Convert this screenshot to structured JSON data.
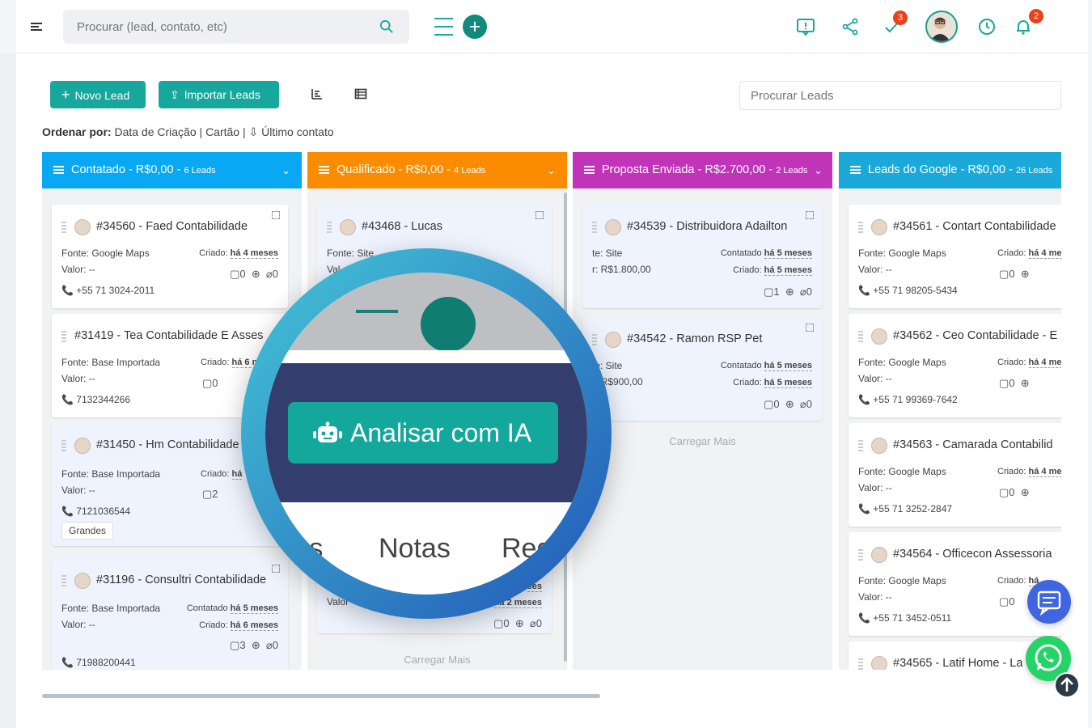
{
  "topbar": {
    "search_placeholder": "Procurar (lead, contato, etc)",
    "tasks_badge": "3",
    "notifications_badge": "2"
  },
  "toolbar": {
    "new_lead": "Novo Lead",
    "import_leads": "Importar Leads",
    "search_leads_placeholder": "Procurar Leads",
    "sort_label": "Ordenar por:",
    "sort_date": "Data de Criação",
    "sort_card": "Cartão",
    "sort_last": "Último contato"
  },
  "columns": [
    {
      "title": "Contatado - R$0,00 -",
      "count": "6 Leads",
      "color": "#0aa8f2"
    },
    {
      "title": "Qualificado - R$0,00 -",
      "count": "4 Leads",
      "color": "#fb8c00"
    },
    {
      "title": "Proposta Enviada - R$2.700,00 -",
      "count": "2 Leads",
      "color": "#c035b8"
    },
    {
      "title": "Leads do Google - R$0,00 -",
      "count": "26 Leads",
      "color": "#1aa9d8"
    }
  ],
  "cards": {
    "c1": {
      "title": "#34560 - Faed Contabilidade",
      "source": "Fonte: Google Maps",
      "value": "Valor: --",
      "created_label": "Criado:",
      "created": "há 4 meses",
      "notes": "0",
      "files": "0",
      "phone": "+55 71 3024-2011"
    },
    "c2": {
      "title": "#31419 - Tea Contabilidade E Asses",
      "source": "Fonte: Base Importada",
      "value": "Valor: --",
      "created_label": "Criado:",
      "created": "há 6 m",
      "notes": "0",
      "phone": "7132344266"
    },
    "c3": {
      "title": "#31450 - Hm Contabilidade",
      "source": "Fonte: Base Importada",
      "value": "Valor: --",
      "created_label": "Criado:",
      "created": "há",
      "notes": "2",
      "phone": "7121036544",
      "tag": "Grandes"
    },
    "c4": {
      "title": "#31196 - Consultri Contabilidade",
      "source": "Fonte: Base Importada",
      "value": "Valor: --",
      "contacted_label": "Contatado",
      "contacted": "há 5 meses",
      "created_label": "Criado:",
      "created": "há 6 meses",
      "notes": "3",
      "files": "0",
      "phone": "71988200441"
    },
    "q1": {
      "title": "#43468 - Lucas",
      "source": "Fonte: Site",
      "value": "Val",
      "notes": "0",
      "files": "0",
      "value2": "Valor",
      "contacted": "ses",
      "created": "há 2 meses"
    },
    "p1": {
      "title": "#34539 - Distribuidora Adailton",
      "source": "te: Site",
      "value": "r: R$1.800,00",
      "contacted_label": "Contatado",
      "contacted": "há 5 meses",
      "created_label": "Criado:",
      "created": "há 5 meses",
      "notes": "1",
      "files": "0"
    },
    "p2": {
      "title": "#34542 - Ramon RSP Pet",
      "source": "te: Site",
      "value": "r: R$900,00",
      "contacted_label": "Contatado",
      "contacted": "há 5 meses",
      "created_label": "Criado:",
      "created": "há 5 meses",
      "notes": "0",
      "files": "0"
    },
    "g1": {
      "title": "#34561 - Contart Contabilidade",
      "source": "Fonte: Google Maps",
      "value": "Valor: --",
      "created_label": "Criado:",
      "created": "há 4 me",
      "notes": "0",
      "phone": "+55 71 98205-5434"
    },
    "g2": {
      "title": "#34562 - Ceo Contabilidade - E",
      "source": "Fonte: Google Maps",
      "value": "Valor: --",
      "created_label": "Criado:",
      "created": "há 4 me",
      "notes": "0",
      "phone": "+55 71 99369-7642"
    },
    "g3": {
      "title": "#34563 - Camarada Contabilid",
      "source": "Fonte: Google Maps",
      "value": "Valor: --",
      "created_label": "Criado:",
      "created": "há 4 me",
      "notes": "0",
      "phone": "+55 71 3252-2847"
    },
    "g4": {
      "title": "#34564 - Officecon Assessoria",
      "source": "Fonte: Google Maps",
      "value": "Valor: --",
      "created_label": "Criado:",
      "created": "há",
      "notes": "0",
      "phone": "+55 71 3452-0511"
    },
    "g5": {
      "title": "#34565 - Latif Home - La"
    }
  },
  "load_more": "Carregar Mais",
  "zoom": {
    "ai_button": "Analisar com IA",
    "tab_partial": "tes",
    "tab_notes": "Notas",
    "tab_registers": "Regis"
  }
}
